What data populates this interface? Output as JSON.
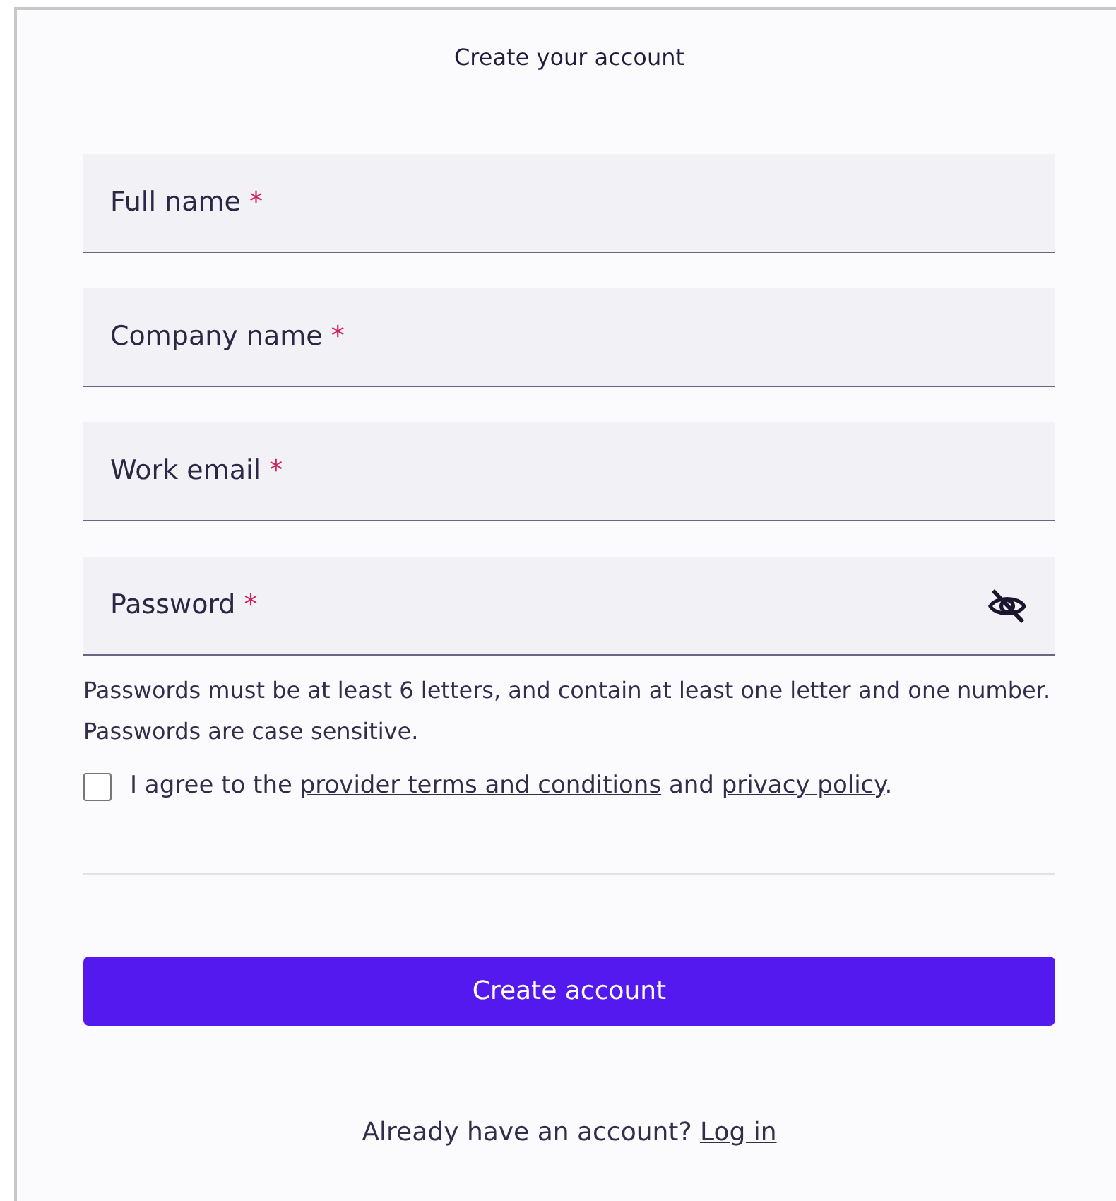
{
  "title": "Create your account",
  "fields": [
    {
      "label": "Full name",
      "required_mark": "*",
      "kind": "text"
    },
    {
      "label": "Company name",
      "required_mark": "*",
      "kind": "text"
    },
    {
      "label": "Work email",
      "required_mark": "*",
      "kind": "email"
    },
    {
      "label": "Password",
      "required_mark": "*",
      "kind": "password"
    }
  ],
  "password_hint": "Passwords must be at least 6 letters, and contain at least one letter and one number. Passwords are case sensitive.",
  "agreement": {
    "checked": false,
    "parts": [
      {
        "kind": "text",
        "text": "I agree to the "
      },
      {
        "kind": "link",
        "text": "provider terms and conditions"
      },
      {
        "kind": "text",
        "text": " and "
      },
      {
        "kind": "link",
        "text": "privacy policy"
      },
      {
        "kind": "text",
        "text": "."
      }
    ]
  },
  "submit": "Create account",
  "login_prompt": {
    "text": "Already have an account?",
    "link": "Log in"
  }
}
